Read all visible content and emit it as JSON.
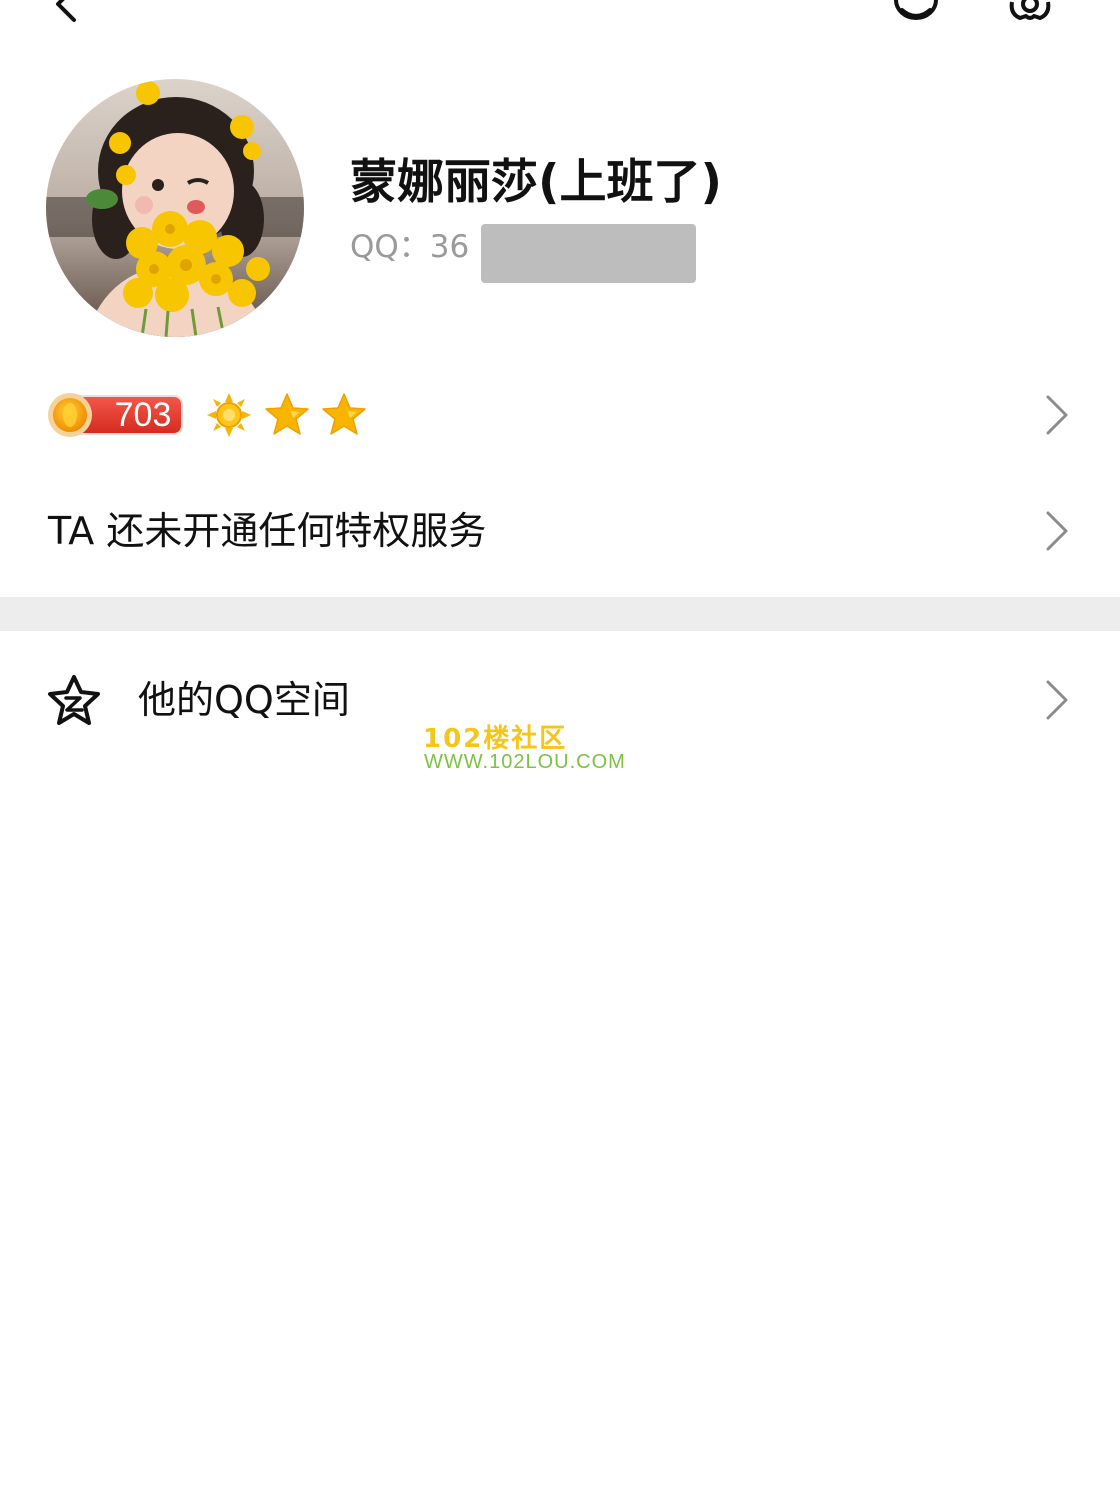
{
  "top_bar": {
    "back_icon": "chevron-left-icon",
    "friend_icon": "penguin-icon",
    "settings_icon": "gear-icon"
  },
  "profile": {
    "avatar_icon": "avatar-photo",
    "nickname": "蒙娜丽莎(上班了)",
    "qq_label": "QQ：36",
    "qq_number_redacted": true
  },
  "level": {
    "value": "703",
    "icons": [
      "sun-icon",
      "star-icon",
      "star-icon"
    ]
  },
  "privilege": {
    "text": "TA 还未开通任何特权服务"
  },
  "qzone": {
    "label": "他的QQ空间",
    "icon": "qzone-star-icon"
  },
  "watermark": {
    "line1": "102楼社区",
    "line2": "WWW.102LOU.COM"
  },
  "colors": {
    "section_gap": "#ededed",
    "secondary_text": "#9a9a9a",
    "level_badge_red": "#e8302a",
    "star_yellow": "#f7b500",
    "watermark_yellow": "#f5c518",
    "watermark_green": "#7dc242"
  }
}
